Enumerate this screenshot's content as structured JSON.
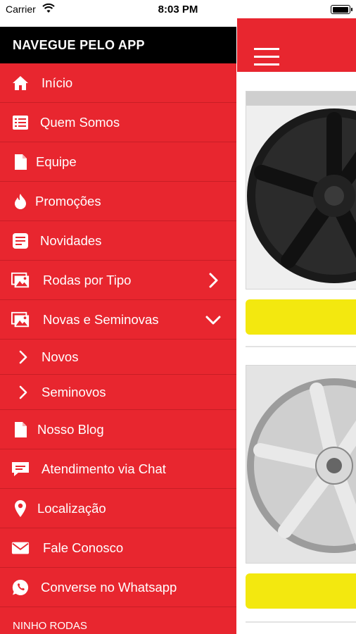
{
  "status_bar": {
    "carrier": "Carrier",
    "time": "8:03 PM"
  },
  "drawer": {
    "title": "NAVEGUE PELO APP",
    "items": [
      {
        "label": "Início",
        "icon": "home-icon"
      },
      {
        "label": "Quem Somos",
        "icon": "list-icon"
      },
      {
        "label": "Equipe",
        "icon": "document-icon"
      },
      {
        "label": "Promoções",
        "icon": "flame-icon"
      },
      {
        "label": "Novidades",
        "icon": "note-icon"
      },
      {
        "label": "Rodas por Tipo",
        "icon": "image-icon",
        "trailing": "chevron-right-icon"
      },
      {
        "label": "Novas e Seminovas",
        "icon": "image-icon",
        "trailing": "chevron-down-icon"
      },
      {
        "label": "Novos",
        "icon": "chevron-right-icon",
        "sub": true
      },
      {
        "label": "Seminovos",
        "icon": "chevron-right-icon",
        "sub": true
      },
      {
        "label": "Nosso Blog",
        "icon": "document-icon"
      },
      {
        "label": "Atendimento via Chat",
        "icon": "chat-icon"
      },
      {
        "label": "Localização",
        "icon": "location-pin-icon"
      },
      {
        "label": "Fale Conosco",
        "icon": "mail-icon"
      },
      {
        "label": "Converse no Whatsapp",
        "icon": "whatsapp-icon"
      }
    ],
    "footer": "NINHO RODAS"
  },
  "colors": {
    "accent_red": "#e8262f",
    "header_black": "#000000",
    "button_yellow": "#f3e80f"
  }
}
